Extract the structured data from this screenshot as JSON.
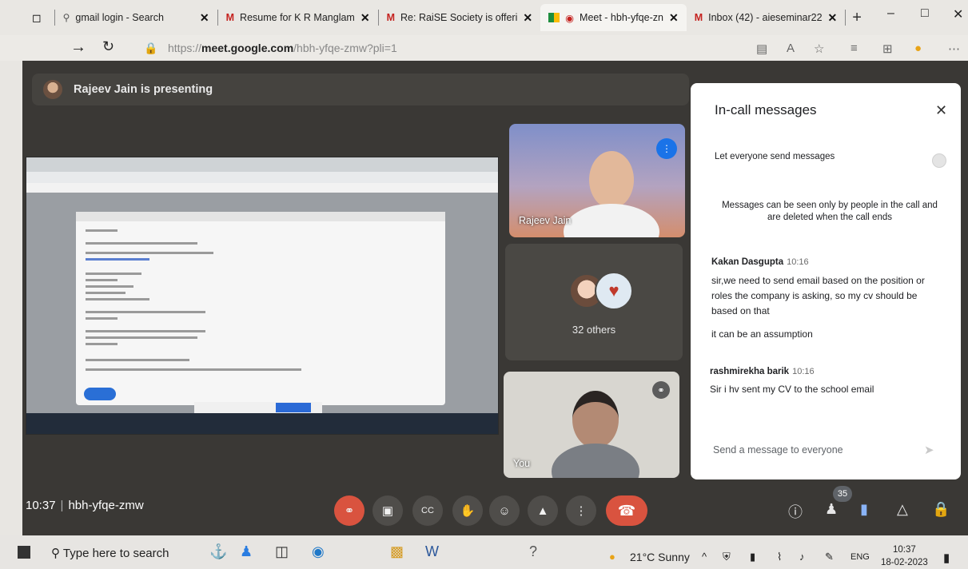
{
  "browser": {
    "tabs": [
      {
        "title": "gmail login - Search",
        "icon": "search-icon"
      },
      {
        "title": "Resume for K R Manglam",
        "icon": "gmail-icon"
      },
      {
        "title": "Re: RaiSE Society is offeri",
        "icon": "gmail-icon"
      },
      {
        "title": "Meet - hbh-yfqe-zn",
        "icon": "meet-icon"
      },
      {
        "title": "Inbox (42) - aieseminar22",
        "icon": "gmail-icon"
      }
    ],
    "new_tab_symbol": "+",
    "url_prefix": "https://",
    "url_host": "meet.google.com",
    "url_path": "/hbh-yfqe-zmw?pli=1"
  },
  "meet": {
    "presenting_text": "Rajeev Jain is presenting",
    "tiles": {
      "rajeev_name": "Rajeev Jain",
      "others_text": "32 others",
      "you_name": "You"
    },
    "time": "10:37",
    "meeting_code": "hbh-yfqe-zmw",
    "people_count": "35"
  },
  "chat": {
    "title": "In-call messages",
    "toggle_label": "Let everyone send messages",
    "notice": "Messages can be seen only by people in the call and are deleted when the call ends",
    "messages": [
      {
        "sender": "Kakan Dasgupta",
        "time": "10:16",
        "lines": [
          "sir,we need to send email based on the position or roles the company is asking, so my cv should be based on that",
          "it can be an assumption"
        ]
      },
      {
        "sender": "rashmirekha barik",
        "time": "10:16",
        "lines": [
          "Sir i hv sent my CV to the school email"
        ]
      }
    ],
    "input_placeholder": "Send a message to everyone"
  },
  "taskbar": {
    "search_placeholder": "Type here to search",
    "weather": "21°C Sunny",
    "language": "ENG",
    "clock_time": "10:37",
    "clock_date": "18-02-2023"
  },
  "colors": {
    "meet_bg": "#3a3835",
    "end_call": "#d9533f",
    "speaking_blue": "#1a73e8"
  }
}
